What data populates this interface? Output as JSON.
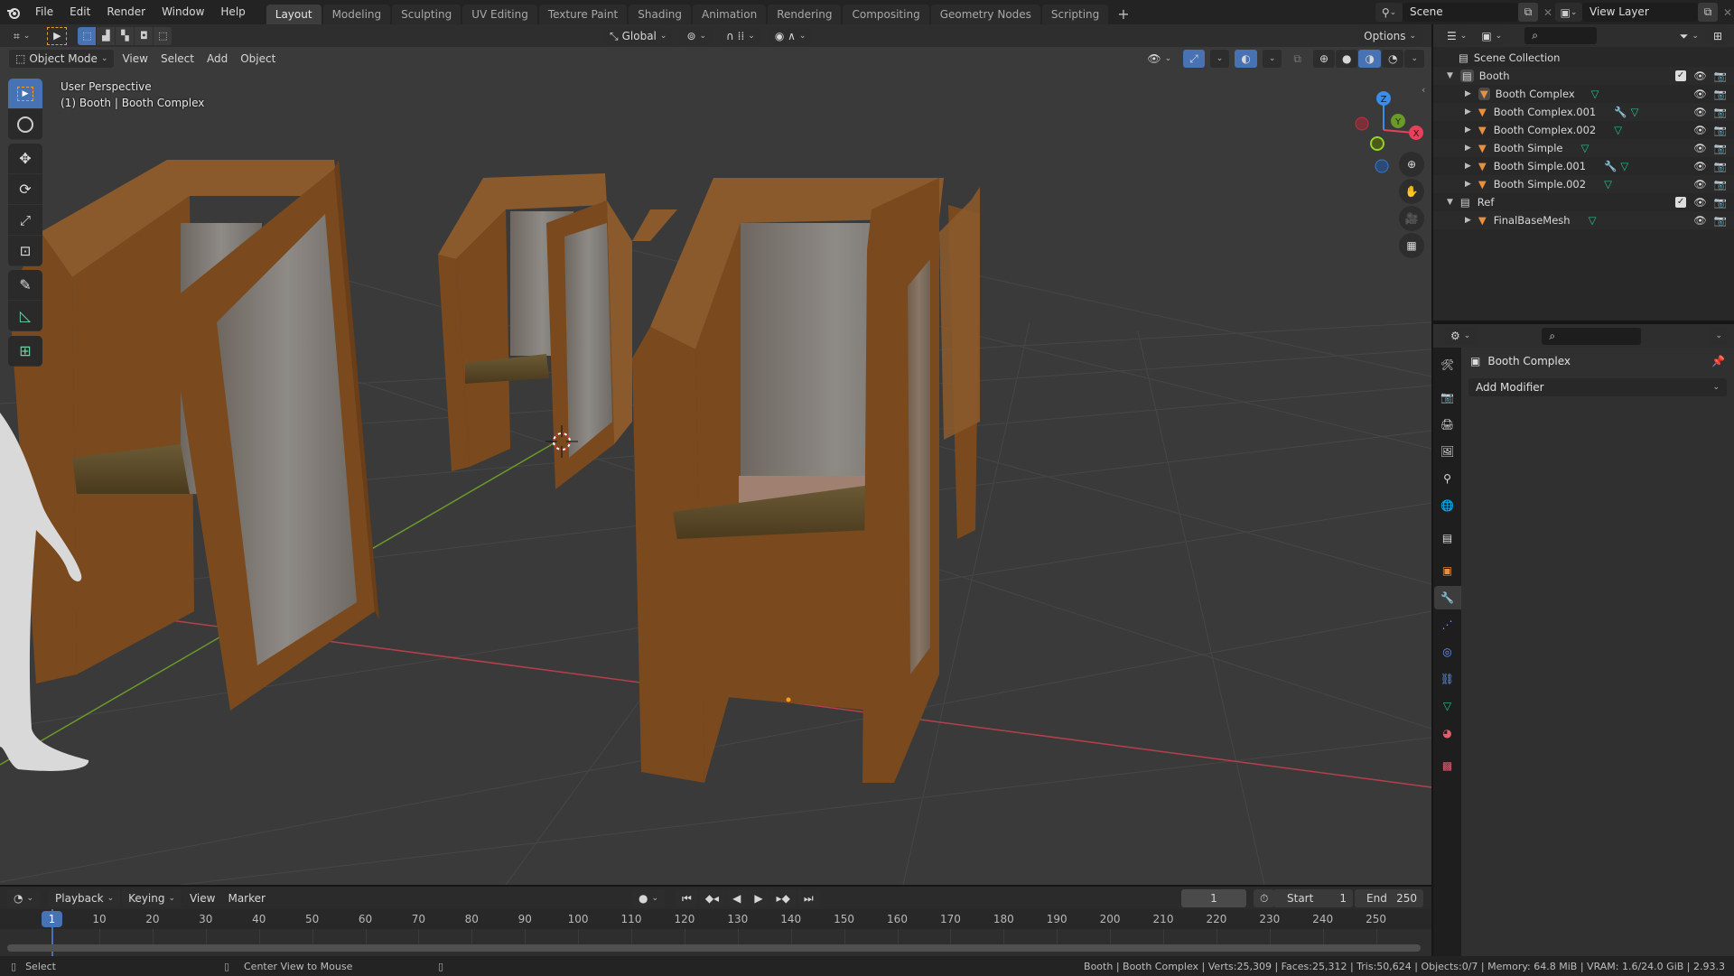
{
  "app": {
    "name": "Blender",
    "version": "2.93.3"
  },
  "topbar": {
    "menus": [
      "File",
      "Edit",
      "Render",
      "Window",
      "Help"
    ],
    "workspaces": [
      "Layout",
      "Modeling",
      "Sculpting",
      "UV Editing",
      "Texture Paint",
      "Shading",
      "Animation",
      "Rendering",
      "Compositing",
      "Geometry Nodes",
      "Scripting"
    ],
    "active_workspace": "Layout",
    "add_workspace": "+",
    "scene": "Scene",
    "view_layer": "View Layer"
  },
  "tool_header": {
    "transform_orientation": "Global",
    "options_label": "Options"
  },
  "viewport_header": {
    "mode": "Object Mode",
    "menus": [
      "View",
      "Select",
      "Add",
      "Object"
    ]
  },
  "viewport": {
    "view_name": "User Perspective",
    "object_info": "(1) Booth | Booth Complex",
    "gizmo_axes": [
      "Z",
      "Y",
      "X"
    ],
    "toolbar": [
      "select-box",
      "cursor",
      "move",
      "rotate",
      "scale",
      "transform",
      "annotate",
      "measure",
      "add-cube"
    ],
    "nav": [
      "zoom",
      "pan",
      "camera",
      "ortho-toggle"
    ],
    "colors": {
      "booth_wood": "#7a4a1e",
      "booth_edge": "#8a5a2c",
      "panel": "#7d7670",
      "seat": "#5e4a26",
      "x_axis": "#b5404c",
      "y_axis": "#6a9a2a"
    }
  },
  "outliner": {
    "root": "Scene Collection",
    "collections": [
      {
        "name": "Booth",
        "checked": true,
        "children": [
          {
            "name": "Booth Complex",
            "modifier": false,
            "active": true
          },
          {
            "name": "Booth Complex.001",
            "modifier": true
          },
          {
            "name": "Booth Complex.002",
            "modifier": false
          },
          {
            "name": "Booth Simple",
            "modifier": false
          },
          {
            "name": "Booth Simple.001",
            "modifier": true
          },
          {
            "name": "Booth Simple.002",
            "modifier": false
          }
        ]
      },
      {
        "name": "Ref",
        "checked": true,
        "children": [
          {
            "name": "FinalBaseMesh",
            "modifier": false
          }
        ]
      }
    ]
  },
  "properties": {
    "object_name": "Booth Complex",
    "add_modifier_label": "Add Modifier",
    "tabs": [
      "tool",
      "render",
      "output",
      "view-layer",
      "scene",
      "world",
      "collection",
      "object",
      "modifiers",
      "particles",
      "physics",
      "constraints",
      "data",
      "material",
      "texture"
    ],
    "active_tab": "modifiers"
  },
  "timeline": {
    "menus": [
      "Playback",
      "Keying",
      "View",
      "Marker"
    ],
    "current_frame": "1",
    "start_label": "Start",
    "start": "1",
    "end_label": "End",
    "end": "250",
    "ticks": [
      "10",
      "20",
      "30",
      "40",
      "50",
      "60",
      "70",
      "80",
      "90",
      "100",
      "110",
      "120",
      "130",
      "140",
      "150",
      "160",
      "170",
      "180",
      "190",
      "200",
      "210",
      "220",
      "230",
      "240",
      "250"
    ]
  },
  "statusbar": {
    "left_hint": "Select",
    "middle_hint": "Center View to Mouse",
    "stats": "Booth | Booth Complex | Verts:25,309 | Faces:25,312 | Tris:50,624 | Objects:0/7 | Memory: 64.8 MiB | VRAM: 1.6/24.0 GiB | 2.93.3"
  }
}
